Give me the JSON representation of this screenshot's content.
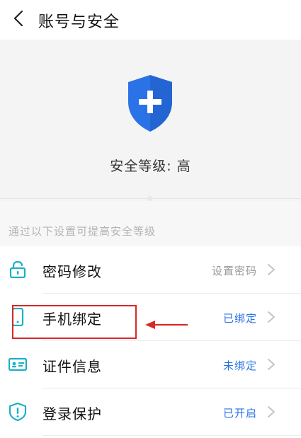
{
  "header": {
    "title": "账号与安全",
    "back_icon": "chevron-left-icon"
  },
  "hero": {
    "shield_icon": "shield-plus-icon",
    "security_level": "安全等级: 高",
    "shield_color": "#2b72e6"
  },
  "hint": "通过以下设置可提高安全等级",
  "items": [
    {
      "icon": "lock-icon",
      "label": "密码修改",
      "value": "设置密码",
      "value_color": "#999999"
    },
    {
      "icon": "phone-icon",
      "label": "手机绑定",
      "value": "已绑定",
      "value_color": "#2b72e6"
    },
    {
      "icon": "id-card-icon",
      "label": "证件信息",
      "value": "未绑定",
      "value_color": "#2b72e6"
    },
    {
      "icon": "shield-alert-icon",
      "label": "登录保护",
      "value": "已开启",
      "value_color": "#2b72e6"
    }
  ],
  "colors": {
    "accent": "#2b72e6",
    "icon_teal": "#1ab0c8",
    "annotation_red": "#d82828"
  }
}
